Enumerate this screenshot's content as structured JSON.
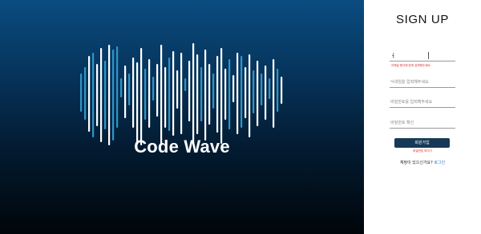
{
  "hero": {
    "brand_name": "Code Wave",
    "wave_colors": [
      "#ffffff",
      "#2f95c8"
    ],
    "background_top": "#0a4c80",
    "background_bottom": "#000509"
  },
  "signup": {
    "title": "SIGN UP",
    "fields": [
      {
        "name": "id-field",
        "value": "ㅓ",
        "placeholder": ""
      },
      {
        "name": "nickname-field",
        "value": "",
        "placeholder": "닉네임을 입력해주세요"
      },
      {
        "name": "password-field",
        "value": "",
        "placeholder": "비밀번호를 입력해주세요"
      },
      {
        "name": "password-confirm-field",
        "value": "",
        "placeholder": "비밀번호 확인"
      }
    ],
    "id_error": "이메일 형식에 맞게 입력해주세요.",
    "submit_label": "회원가입",
    "helper_text": "비밀번호 보이기",
    "login_prompt": "계정이 있으신가요?",
    "login_link": "로그인"
  }
}
